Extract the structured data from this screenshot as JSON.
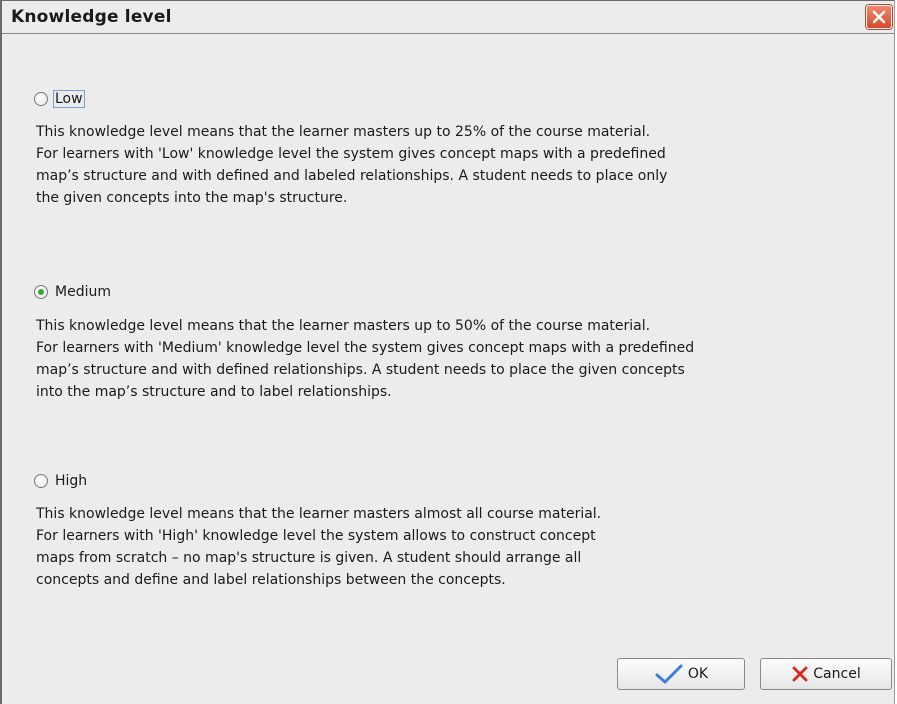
{
  "window": {
    "title": "Knowledge level"
  },
  "options": [
    {
      "label": "Low",
      "selected": false,
      "description": [
        "This knowledge level means that the learner masters up to 25% of the course material.",
        "For learners with 'Low' knowledge level the system gives concept maps with a predefined",
        "map’s structure and with defined and labeled relationships. A student needs to place only",
        "the given concepts into the map's structure."
      ]
    },
    {
      "label": "Medium",
      "selected": true,
      "description": [
        "This knowledge level means that the learner masters up to 50% of the course material.",
        "For learners with 'Medium' knowledge level the system gives concept maps with a predefined",
        "map’s structure and with defined relationships. A student needs to place the given concepts",
        "into the map’s structure and to label relationships."
      ]
    },
    {
      "label": "High",
      "selected": false,
      "description": [
        "This knowledge level means that the learner masters almost all course material.",
        "For learners with 'High' knowledge level the system allows to construct concept",
        "maps from scratch – no map's structure is given. A student should arrange all",
        "concepts and define and label relationships between the concepts."
      ]
    }
  ],
  "buttons": {
    "ok": "OK",
    "cancel": "Cancel"
  },
  "icons": {
    "close": "close-icon",
    "ok": "checkmark-icon",
    "cancel": "x-icon"
  },
  "colors": {
    "radio_selected": "#3aa337",
    "close_button": "#d8462a",
    "ok_check": "#3d7fd6",
    "cancel_x": "#d62a1a"
  }
}
